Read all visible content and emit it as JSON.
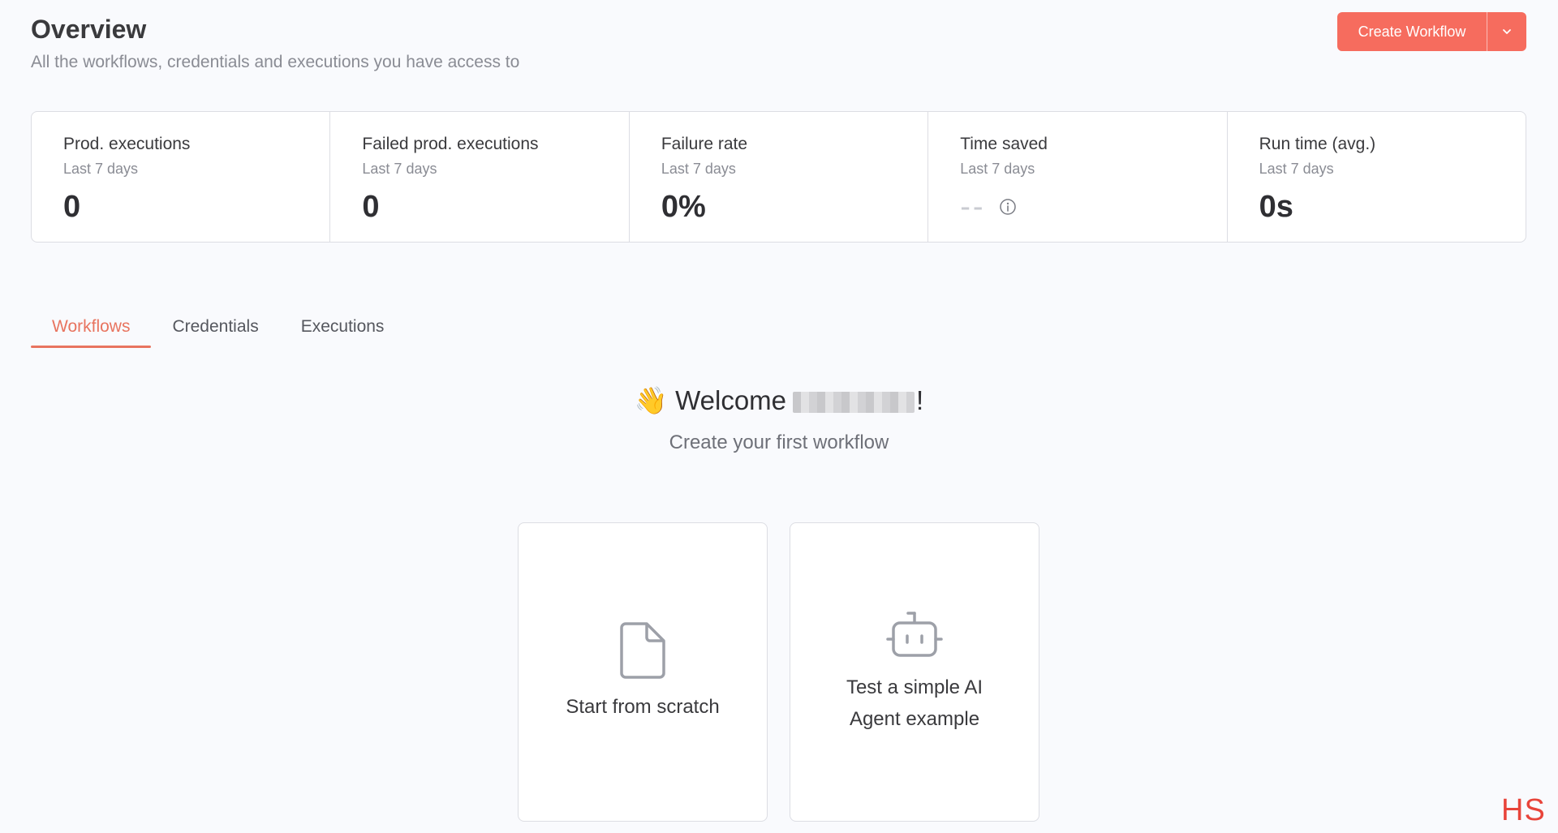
{
  "header": {
    "title": "Overview",
    "subtitle": "All the workflows, credentials and executions you have access to"
  },
  "create_button": {
    "label": "Create Workflow",
    "caret_icon": "chevron-down-icon"
  },
  "stats": [
    {
      "label": "Prod. executions",
      "period": "Last 7 days",
      "value": "0"
    },
    {
      "label": "Failed prod. executions",
      "period": "Last 7 days",
      "value": "0"
    },
    {
      "label": "Failure rate",
      "period": "Last 7 days",
      "value": "0%"
    },
    {
      "label": "Time saved",
      "period": "Last 7 days",
      "value": "--",
      "icon": "info-icon"
    },
    {
      "label": "Run time (avg.)",
      "period": "Last 7 days",
      "value": "0s"
    }
  ],
  "tabs": [
    {
      "label": "Workflows",
      "active": true
    },
    {
      "label": "Credentials",
      "active": false
    },
    {
      "label": "Executions",
      "active": false
    }
  ],
  "welcome": {
    "emoji": "👋",
    "greeting": "Welcome",
    "suffix": "!",
    "subtitle": "Create your first workflow"
  },
  "cards": [
    {
      "label": "Start from scratch",
      "icon": "file-icon"
    },
    {
      "label": "Test a simple AI Agent example",
      "icon": "robot-icon"
    }
  ],
  "watermark": "HS",
  "colors": {
    "accent": "#f66c5e",
    "tab_active": "#e8745f",
    "background": "#f9fafd"
  }
}
